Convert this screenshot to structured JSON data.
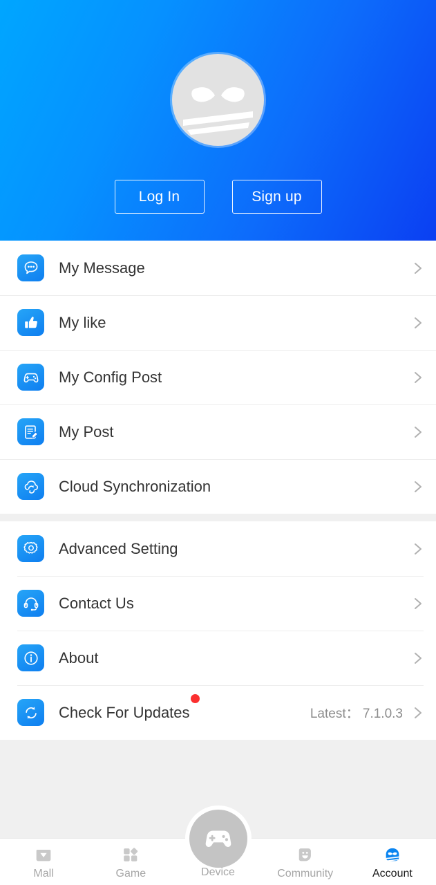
{
  "header": {
    "avatar_icon": "mask-logo-avatar",
    "login_label": "Log In",
    "signup_label": "Sign up",
    "gradient_from": "#00a6ff",
    "gradient_to": "#0b3ff2"
  },
  "menu_groups": [
    {
      "id": "group-a",
      "items": [
        {
          "icon": "message-bubble-icon",
          "label": "My Message",
          "value": "",
          "badge": false
        },
        {
          "icon": "thumbs-up-icon",
          "label": "My like",
          "value": "",
          "badge": false
        },
        {
          "icon": "gamepad-icon",
          "label": "My Config Post",
          "value": "",
          "badge": false
        },
        {
          "icon": "document-edit-icon",
          "label": "My Post",
          "value": "",
          "badge": false
        },
        {
          "icon": "cloud-sync-icon",
          "label": "Cloud Synchronization",
          "value": "",
          "badge": false
        }
      ]
    },
    {
      "id": "group-b",
      "items": [
        {
          "icon": "gear-icon",
          "label": "Advanced Setting",
          "value": "",
          "badge": false
        },
        {
          "icon": "headset-icon",
          "label": "Contact Us",
          "value": "",
          "badge": false
        },
        {
          "icon": "info-circle-icon",
          "label": "About",
          "value": "",
          "badge": false
        },
        {
          "icon": "refresh-sync-icon",
          "label": "Check For Updates",
          "value": "Latest： 7.1.0.3",
          "badge": true
        }
      ]
    }
  ],
  "tabbar": {
    "accent_color": "#0a84f0",
    "items": [
      {
        "id": "mall",
        "icon": "shopping-bag-icon",
        "label": "Mall",
        "active": false
      },
      {
        "id": "game",
        "icon": "grid-blocks-icon",
        "label": "Game",
        "active": false
      },
      {
        "id": "device",
        "icon": "gamepad-filled-icon",
        "label": "Device",
        "active": false
      },
      {
        "id": "community",
        "icon": "smiley-bubble-icon",
        "label": "Community",
        "active": false
      },
      {
        "id": "account",
        "icon": "mask-logo-icon",
        "label": "Account",
        "active": true
      }
    ]
  }
}
